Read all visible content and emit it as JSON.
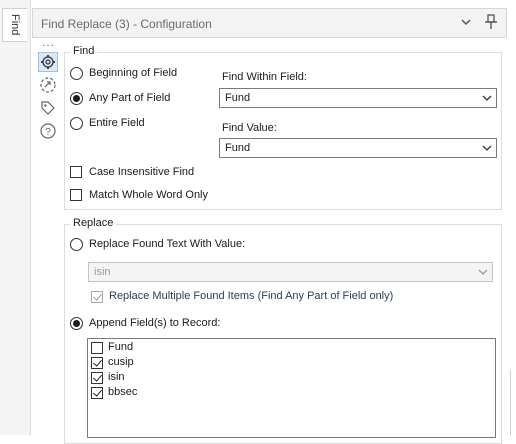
{
  "side_tab": {
    "label": "Find"
  },
  "header": {
    "title": "Find Replace (3) - Configuration",
    "collapse_icon": "chevron-down-icon",
    "pin_icon": "pin-icon"
  },
  "toolbar_icons": [
    "gear-icon",
    "connection-icon",
    "tag-icon",
    "help-icon"
  ],
  "find": {
    "group_label": "Find",
    "options": [
      {
        "label": "Beginning of Field",
        "selected": false
      },
      {
        "label": "Any Part of Field",
        "selected": true
      },
      {
        "label": "Entire Field",
        "selected": false
      }
    ],
    "within_field_label": "Find Within Field:",
    "within_field_value": "Fund",
    "find_value_label": "Find Value:",
    "find_value": "Fund",
    "case_insensitive_label": "Case Insensitive Find",
    "case_insensitive_checked": false,
    "whole_word_label": "Match Whole Word Only",
    "whole_word_checked": false
  },
  "replace": {
    "group_label": "Replace",
    "replace_text_label": "Replace Found Text With Value:",
    "replace_text_selected": false,
    "replace_value": "isin",
    "multiple_label": "Replace Multiple Found Items (Find Any Part of Field only)",
    "multiple_checked": true,
    "append_label": "Append Field(s) to Record:",
    "append_selected": true,
    "fields": [
      {
        "label": "Fund",
        "checked": false
      },
      {
        "label": "cusip",
        "checked": true
      },
      {
        "label": "isin",
        "checked": true
      },
      {
        "label": "bbsec",
        "checked": true
      }
    ]
  },
  "colors": {
    "selected_icon_bg": "#dbe8f6",
    "border": "#dcdcdc",
    "header_bg": "#f3f3f3"
  }
}
